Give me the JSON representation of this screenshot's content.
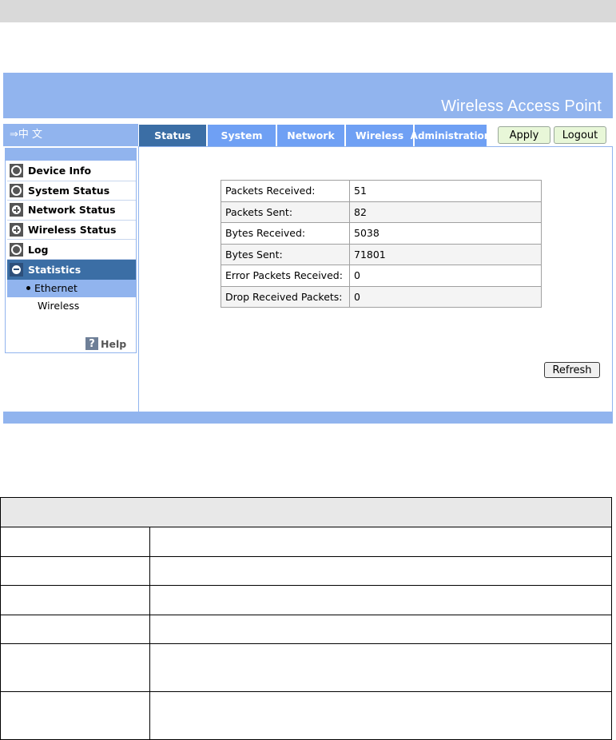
{
  "header": {
    "title": "Wireless Access Point",
    "language_link": "⇒中 文"
  },
  "nav": {
    "tabs": [
      {
        "label": "Status",
        "active": true
      },
      {
        "label": "System"
      },
      {
        "label": "Network"
      },
      {
        "label": "Wireless"
      },
      {
        "label": "Administration"
      }
    ],
    "apply_label": "Apply",
    "logout_label": "Logout"
  },
  "sidebar": {
    "items": [
      {
        "label": "Device Info",
        "icon": "circle-icon"
      },
      {
        "label": "System Status",
        "icon": "circle-icon"
      },
      {
        "label": "Network Status",
        "icon": "plus-icon"
      },
      {
        "label": "Wireless Status",
        "icon": "plus-icon"
      },
      {
        "label": "Log",
        "icon": "circle-icon"
      },
      {
        "label": "Statistics",
        "icon": "minus-icon",
        "active": true
      }
    ],
    "subitems": [
      {
        "label": "Ethernet",
        "active": true
      },
      {
        "label": "Wireless"
      }
    ],
    "help_label": "Help",
    "help_icon_glyph": "?"
  },
  "statistics": {
    "rows": [
      {
        "label": "Packets Received:",
        "value": "51"
      },
      {
        "label": "Packets Sent:",
        "value": "82"
      },
      {
        "label": "Bytes Received:",
        "value": "5038"
      },
      {
        "label": "Bytes Sent:",
        "value": "71801"
      },
      {
        "label": "Error Packets Received:",
        "value": "0"
      },
      {
        "label": "Drop Received Packets:",
        "value": "0"
      }
    ]
  },
  "refresh_label": "Refresh",
  "colors": {
    "banner": "#91b4ee",
    "tab": "#6fa0f4",
    "active": "#3b6ea5"
  }
}
